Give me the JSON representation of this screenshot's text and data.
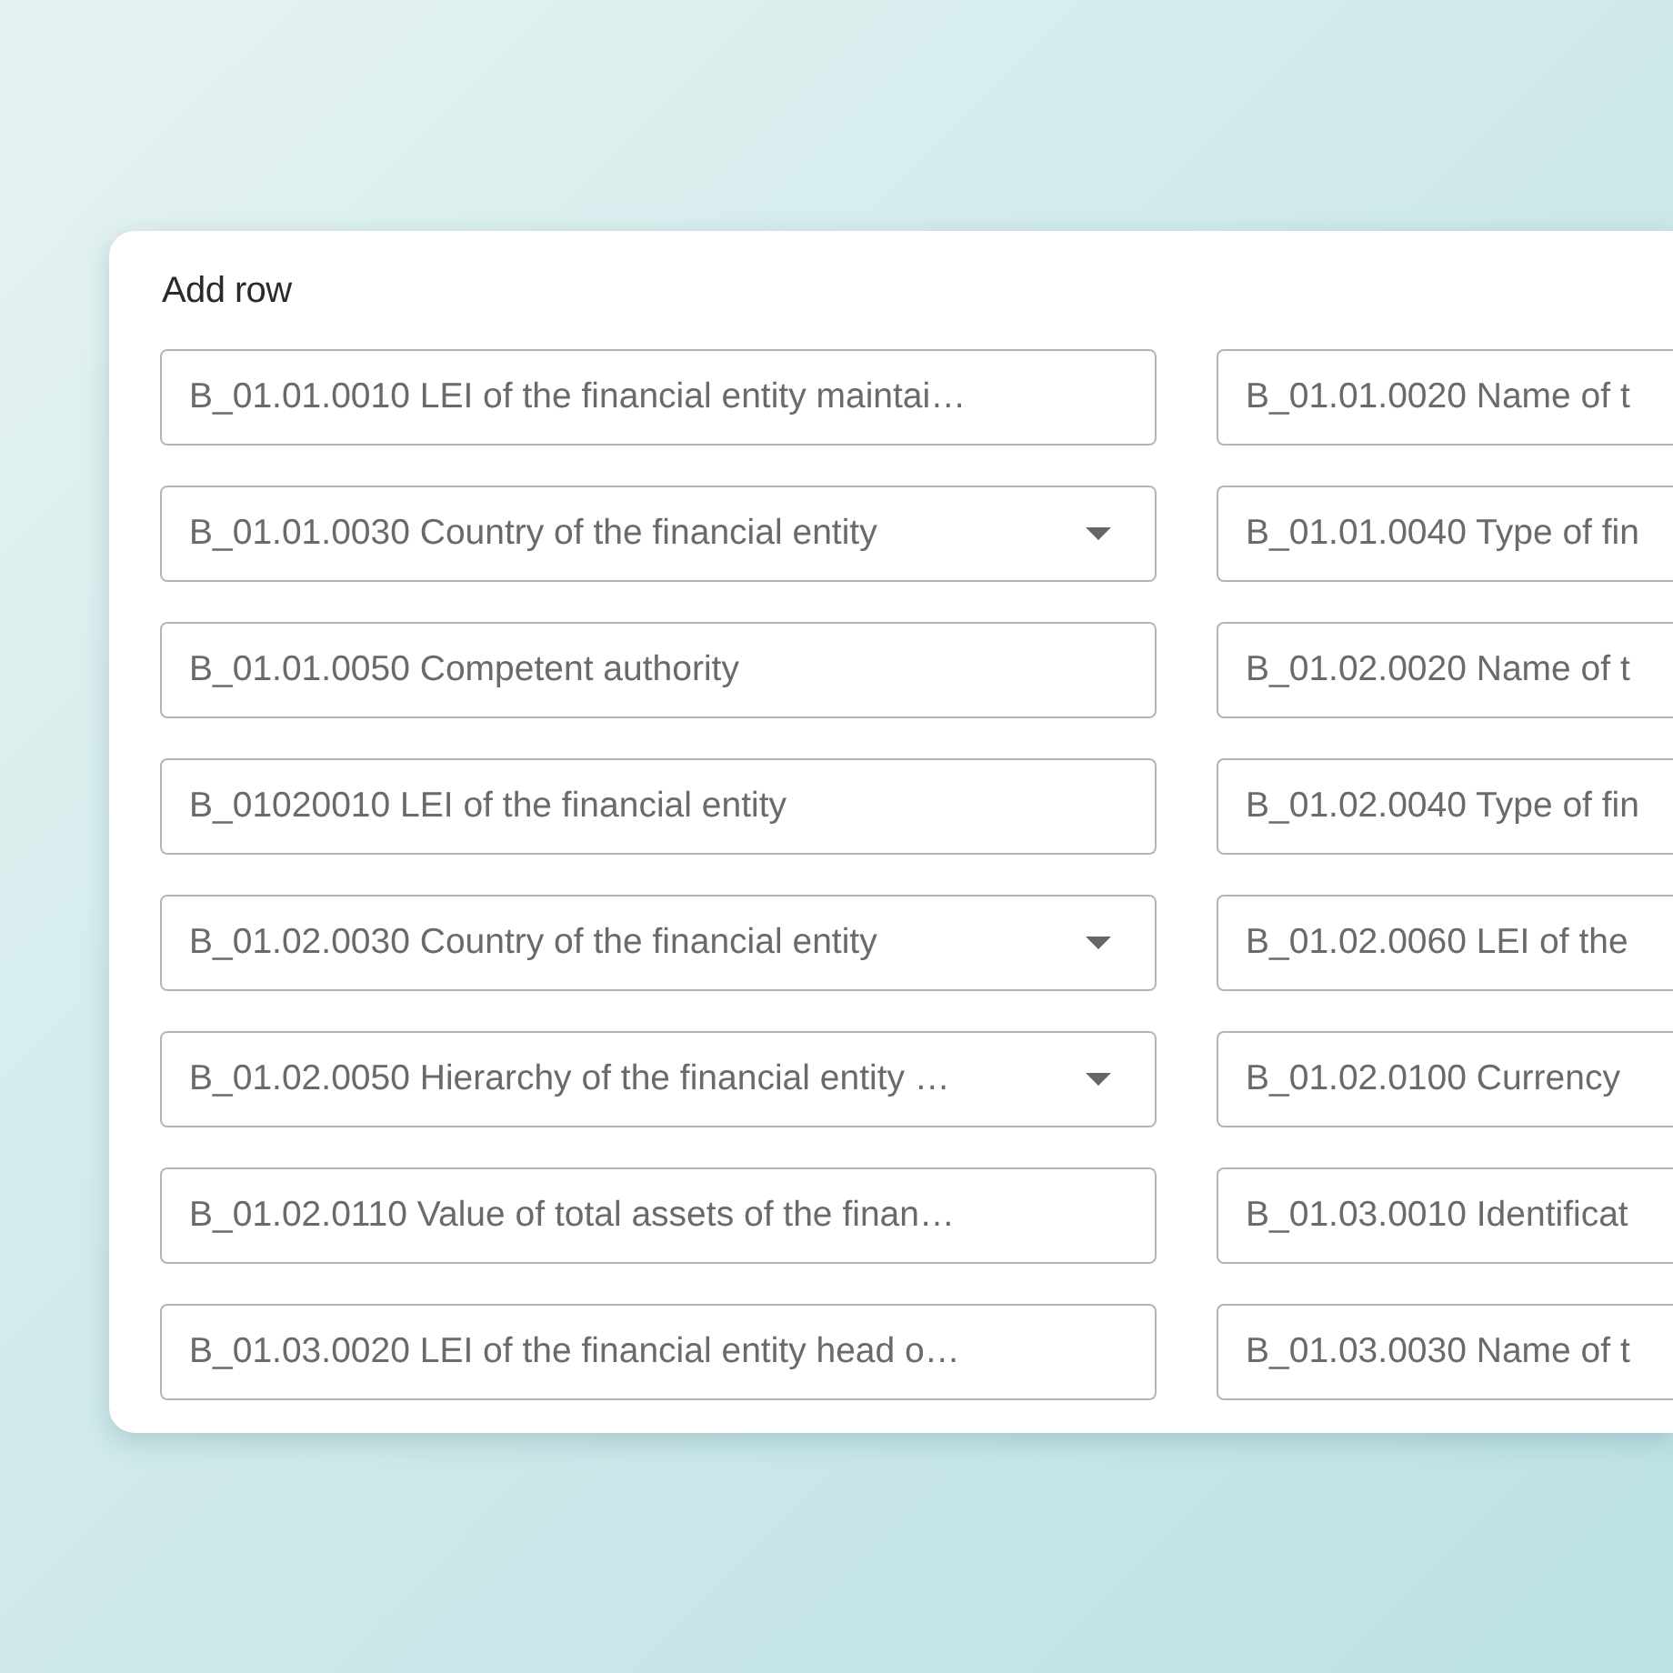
{
  "card": {
    "title": "Add row"
  },
  "fields": [
    {
      "kind": "text",
      "placeholder": "B_01.01.0010 LEI of the financial entity maintai…"
    },
    {
      "kind": "text",
      "placeholder": "B_01.01.0020 Name of t"
    },
    {
      "kind": "select",
      "placeholder": "B_01.01.0030 Country of the financial entity"
    },
    {
      "kind": "text",
      "placeholder": "B_01.01.0040 Type of fin"
    },
    {
      "kind": "text",
      "placeholder": "B_01.01.0050 Competent authority"
    },
    {
      "kind": "text",
      "placeholder": "B_01.02.0020 Name of t"
    },
    {
      "kind": "text",
      "placeholder": "B_01020010 LEI of the financial entity"
    },
    {
      "kind": "text",
      "placeholder": "B_01.02.0040 Type of fin"
    },
    {
      "kind": "select",
      "placeholder": "B_01.02.0030 Country of the financial entity"
    },
    {
      "kind": "text",
      "placeholder": "B_01.02.0060 LEI of the"
    },
    {
      "kind": "select",
      "placeholder": "B_01.02.0050 Hierarchy of the financial entity …"
    },
    {
      "kind": "text",
      "placeholder": "B_01.02.0100 Currency"
    },
    {
      "kind": "text",
      "placeholder": "B_01.02.0110 Value of total assets of the finan…"
    },
    {
      "kind": "text",
      "placeholder": "B_01.03.0010 Identificat"
    },
    {
      "kind": "text",
      "placeholder": "B_01.03.0020 LEI of the financial entity head o…"
    },
    {
      "kind": "text",
      "placeholder": "B_01.03.0030 Name of t"
    }
  ]
}
